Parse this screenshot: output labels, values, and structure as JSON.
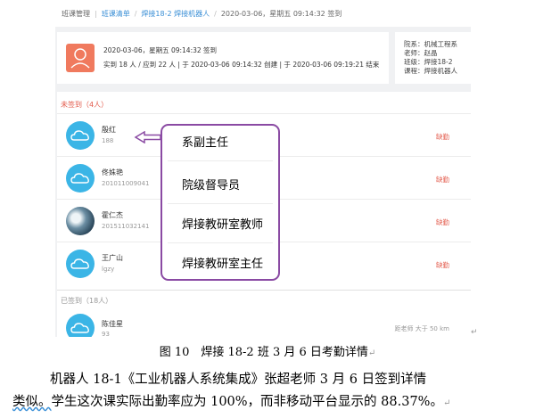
{
  "breadcrumb": {
    "items": [
      "班课管理",
      "班课清单",
      "焊接18-2 焊接机器人",
      "2020-03-06，星期五 09:14:32 签到"
    ]
  },
  "session": {
    "line1": "2020-03-06，星期五 09:14:32 签到",
    "line2": "实到 18 人 / 应到 22 人 | 于 2020-03-06 09:14:32 创建 | 于 2020-03-06 09:19:21 结束"
  },
  "class_info": {
    "school": "院系：机械工程系",
    "teacher": "老师：赵晶",
    "class": "班级：焊接18-2",
    "course": "课程：焊接机器人"
  },
  "absent": {
    "header": "未签到（4人）",
    "rows": [
      {
        "name": "殷红",
        "id": "188",
        "status": "缺勤"
      },
      {
        "name": "佟姝艳",
        "id": "201011009041",
        "status": "缺勤"
      },
      {
        "name": "霍仁杰",
        "id": "201511032141",
        "status": "缺勤"
      },
      {
        "name": "王广山",
        "id": "lgzy",
        "status": "缺勤"
      }
    ]
  },
  "signed": {
    "header": "已签到（18人）",
    "row": {
      "name": "陈佳星",
      "id": "93",
      "right": "距老师 大于 50 km"
    }
  },
  "annotation": [
    "系副主任",
    "院级督导员",
    "焊接教研室教师",
    "焊接教研室主任"
  ],
  "caption": "图 10　焊接 18-2 班 3 月 6 日考勤详情",
  "paragraph": {
    "line1": "机器人 18-1《工业机器人系统集成》张超老师 3 月 6 日签到详情",
    "line2a": "类似。",
    "line2b": "学生这次课实际出勤率应为 100%，而非移动平台显示的 88.37%。"
  },
  "colors": {
    "accent": "#3a8fd6",
    "absent": "#e35a4b",
    "annotation": "#8a4aa3",
    "avatar": "#3bb5e6"
  }
}
